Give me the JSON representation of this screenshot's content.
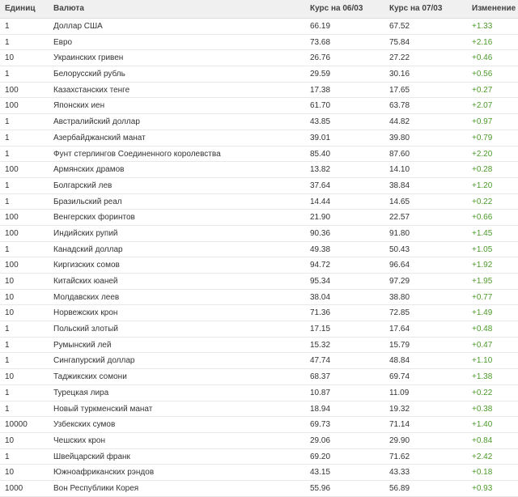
{
  "table": {
    "headers": {
      "units": "Единиц",
      "currency": "Валюта",
      "rate_old": "Курс на 06/03",
      "rate_new": "Курс на 07/03",
      "change": "Изменение"
    },
    "rows": [
      {
        "units": "1",
        "name": "Доллар США",
        "old": "66.19",
        "new": "67.52",
        "change": "+1.33"
      },
      {
        "units": "1",
        "name": "Евро",
        "old": "73.68",
        "new": "75.84",
        "change": "+2.16"
      },
      {
        "units": "10",
        "name": "Украинских гривен",
        "old": "26.76",
        "new": "27.22",
        "change": "+0.46"
      },
      {
        "units": "1",
        "name": "Белорусский рубль",
        "old": "29.59",
        "new": "30.16",
        "change": "+0.56"
      },
      {
        "units": "100",
        "name": "Казахстанских тенге",
        "old": "17.38",
        "new": "17.65",
        "change": "+0.27"
      },
      {
        "units": "100",
        "name": "Японских иен",
        "old": "61.70",
        "new": "63.78",
        "change": "+2.07"
      },
      {
        "units": "1",
        "name": "Австралийский доллар",
        "old": "43.85",
        "new": "44.82",
        "change": "+0.97"
      },
      {
        "units": "1",
        "name": "Азербайджанский манат",
        "old": "39.01",
        "new": "39.80",
        "change": "+0.79"
      },
      {
        "units": "1",
        "name": "Фунт стерлингов Соединенного королевства",
        "old": "85.40",
        "new": "87.60",
        "change": "+2.20"
      },
      {
        "units": "100",
        "name": "Армянских драмов",
        "old": "13.82",
        "new": "14.10",
        "change": "+0.28"
      },
      {
        "units": "1",
        "name": "Болгарский лев",
        "old": "37.64",
        "new": "38.84",
        "change": "+1.20"
      },
      {
        "units": "1",
        "name": "Бразильский реал",
        "old": "14.44",
        "new": "14.65",
        "change": "+0.22"
      },
      {
        "units": "100",
        "name": "Венгерских форинтов",
        "old": "21.90",
        "new": "22.57",
        "change": "+0.66"
      },
      {
        "units": "100",
        "name": "Индийских рупий",
        "old": "90.36",
        "new": "91.80",
        "change": "+1.45"
      },
      {
        "units": "1",
        "name": "Канадский доллар",
        "old": "49.38",
        "new": "50.43",
        "change": "+1.05"
      },
      {
        "units": "100",
        "name": "Киргизских сомов",
        "old": "94.72",
        "new": "96.64",
        "change": "+1.92"
      },
      {
        "units": "10",
        "name": "Китайских юаней",
        "old": "95.34",
        "new": "97.29",
        "change": "+1.95"
      },
      {
        "units": "10",
        "name": "Молдавских леев",
        "old": "38.04",
        "new": "38.80",
        "change": "+0.77"
      },
      {
        "units": "10",
        "name": "Норвежских крон",
        "old": "71.36",
        "new": "72.85",
        "change": "+1.49"
      },
      {
        "units": "1",
        "name": "Польский злотый",
        "old": "17.15",
        "new": "17.64",
        "change": "+0.48"
      },
      {
        "units": "1",
        "name": "Румынский лей",
        "old": "15.32",
        "new": "15.79",
        "change": "+0.47"
      },
      {
        "units": "1",
        "name": "Сингапурский доллар",
        "old": "47.74",
        "new": "48.84",
        "change": "+1.10"
      },
      {
        "units": "10",
        "name": "Таджикских сомони",
        "old": "68.37",
        "new": "69.74",
        "change": "+1.38"
      },
      {
        "units": "1",
        "name": "Турецкая лира",
        "old": "10.87",
        "new": "11.09",
        "change": "+0.22"
      },
      {
        "units": "1",
        "name": "Новый туркменский манат",
        "old": "18.94",
        "new": "19.32",
        "change": "+0.38"
      },
      {
        "units": "10000",
        "name": "Узбекских сумов",
        "old": "69.73",
        "new": "71.14",
        "change": "+1.40"
      },
      {
        "units": "10",
        "name": "Чешских крон",
        "old": "29.06",
        "new": "29.90",
        "change": "+0.84"
      },
      {
        "units": "1",
        "name": "Швейцарский франк",
        "old": "69.20",
        "new": "71.62",
        "change": "+2.42"
      },
      {
        "units": "10",
        "name": "Южноафриканских рэндов",
        "old": "43.15",
        "new": "43.33",
        "change": "+0.18"
      },
      {
        "units": "1000",
        "name": "Вон Республики Корея",
        "old": "55.96",
        "new": "56.89",
        "change": "+0.93"
      }
    ]
  },
  "colors": {
    "positive_change": "#4c9a2a",
    "header_bg": "#f0f0f0"
  }
}
